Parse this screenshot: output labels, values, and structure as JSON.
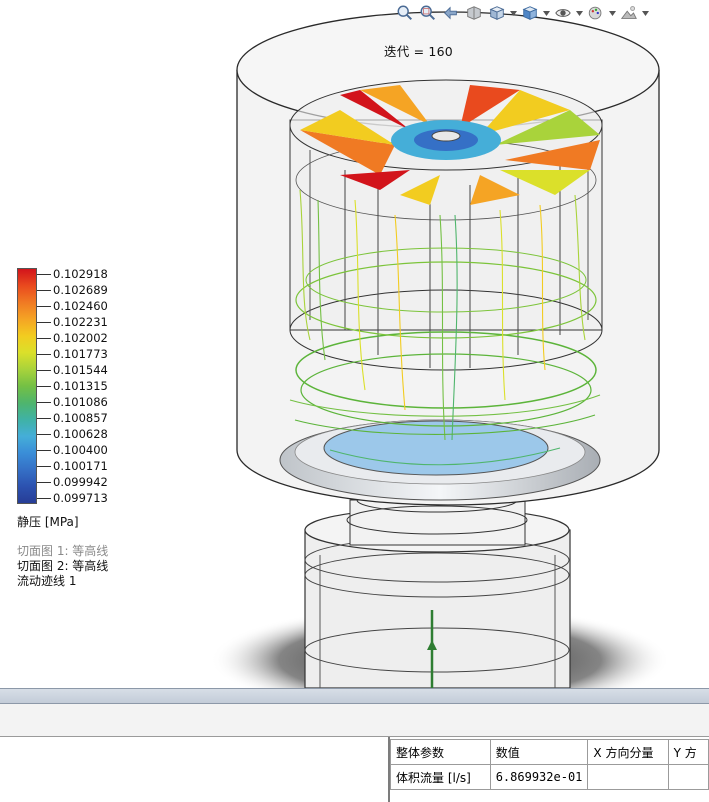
{
  "viewport": {
    "iteration_label": "迭代 = 160",
    "toolbar": [
      {
        "name": "zoom-to-fit-icon"
      },
      {
        "name": "zoom-to-area-icon"
      },
      {
        "name": "previous-view-icon"
      },
      {
        "name": "section-view-icon"
      },
      {
        "name": "view-orientation-icon",
        "dropdown": true
      },
      {
        "name": "display-style-icon",
        "dropdown": true
      },
      {
        "name": "hide-show-items-icon",
        "dropdown": true
      },
      {
        "name": "edit-appearance-icon",
        "dropdown": true
      },
      {
        "name": "apply-scene-icon",
        "dropdown": true
      }
    ],
    "legend": {
      "values": [
        "0.102918",
        "0.102689",
        "0.102460",
        "0.102231",
        "0.102002",
        "0.101773",
        "0.101544",
        "0.101315",
        "0.101086",
        "0.100857",
        "0.100628",
        "0.100400",
        "0.100171",
        "0.099942",
        "0.099713"
      ],
      "colors": [
        "#d2141b",
        "#e94a1e",
        "#f07a23",
        "#f5a424",
        "#f2cc20",
        "#dbe02a",
        "#a9d33b",
        "#74c044",
        "#4fb56c",
        "#3fb2a5",
        "#45aed8",
        "#3a8ed8",
        "#3570c6",
        "#2c52b0",
        "#273d96"
      ],
      "unit": "静压 [MPa]"
    },
    "plots": [
      {
        "label": "切面图 1: 等高线",
        "active": false
      },
      {
        "label": "切面图 2: 等高线",
        "active": true
      },
      {
        "label": "流动迹线 1",
        "active": true
      }
    ]
  },
  "results_table": {
    "headers": [
      "整体参数",
      "数值",
      "X 方向分量",
      "Y 方"
    ],
    "rows": [
      [
        "体积流量 [l/s]",
        "6.869932e-01",
        "",
        ""
      ]
    ]
  },
  "colors": {
    "separator": "#c9d1db",
    "cylinder_fill": "#f2f2f2",
    "outline": "#2a2a2a",
    "outlet_fill": "#9cc8ea"
  }
}
